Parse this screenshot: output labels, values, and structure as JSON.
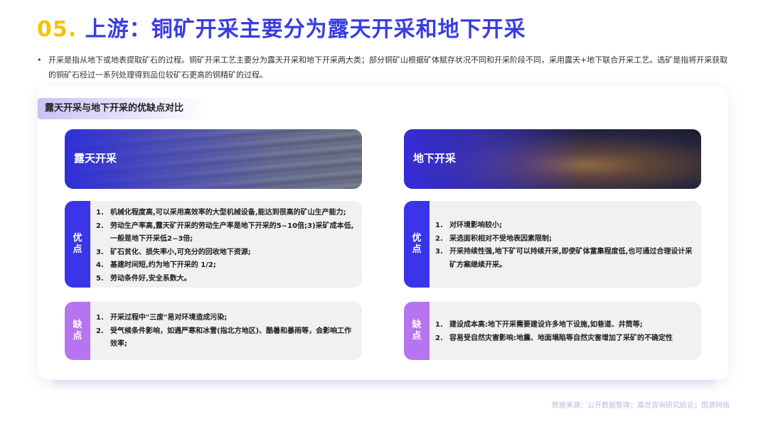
{
  "header": {
    "number": "05.",
    "title": "上游：铜矿开采主要分为露天开采和地下开采"
  },
  "intro": {
    "bullet": "•",
    "text": "开采是指从地下或地表提取矿石的过程。铜矿开采工艺主要分为露天开采和地下开采两大类；部分铜矿山根据矿体赋存状况不同和开采阶段不同，采用露天+地下联合开采工艺。选矿是指将开采获取的铜矿石经过一系列处理得到品位较矿石更高的铜精矿的过程。"
  },
  "section": {
    "title": "露天开采与地下开采的优缺点对比"
  },
  "open_pit": {
    "label": "露天开采",
    "pros_tag": [
      "优",
      "点"
    ],
    "pros": [
      {
        "n": "1.",
        "text": "机械化程度高,可以采用高效率的大型机械设备,能达到很高的矿山生产能力;"
      },
      {
        "n": "2.",
        "text": "劳动生产率高,露天矿开采的劳动生产率是地下开采的5~10倍;3)采矿成本低,一般是地下开采低2~3倍;"
      },
      {
        "n": "3.",
        "text": "矿石贫化、损失率小,可充分的回收地下资源;"
      },
      {
        "n": "4.",
        "text": "基建时间短,约为地下开采的 1/2;"
      },
      {
        "n": "5.",
        "text": "劳动条件好,安全系数大。"
      }
    ],
    "cons_tag": [
      "缺",
      "点"
    ],
    "cons": [
      {
        "n": "1.",
        "text": "开采过程中\"三废\"易对环境造成污染;"
      },
      {
        "n": "2.",
        "text": "受气候条件影响，如遇严寒和冰雪(指北方地区)、酷暑和暴雨等，会影响工作效率;"
      }
    ]
  },
  "underground": {
    "label": "地下开采",
    "pros_tag": [
      "优",
      "点"
    ],
    "pros": [
      {
        "n": "1.",
        "text": "对环境影响较小;"
      },
      {
        "n": "2.",
        "text": "采选面积相对不受地表因素限制;"
      },
      {
        "n": "3.",
        "text": "开采持续性强,地下矿可以持续开采,即使矿体富集程度低,也可通过合理设计采矿方案继续开采。"
      }
    ],
    "cons_tag": [
      "缺",
      "点"
    ],
    "cons": [
      {
        "n": "1.",
        "text": "建设成本高:地下开采需要建设许多地下设施,如巷道、井筒等;"
      },
      {
        "n": "2.",
        "text": "容易受自然灾害影响:地震、地面塌陷等自然灾害增加了采矿的不确定性"
      }
    ]
  },
  "footer": {
    "source": "数据来源：公开数据整理；嘉世咨询研究结论；图源网络"
  },
  "colors": {
    "accent_yellow": "#f5c400",
    "accent_blue": "#3a3de0",
    "pros_tag": "#3a35e8",
    "cons_tag": "#b774f0"
  }
}
